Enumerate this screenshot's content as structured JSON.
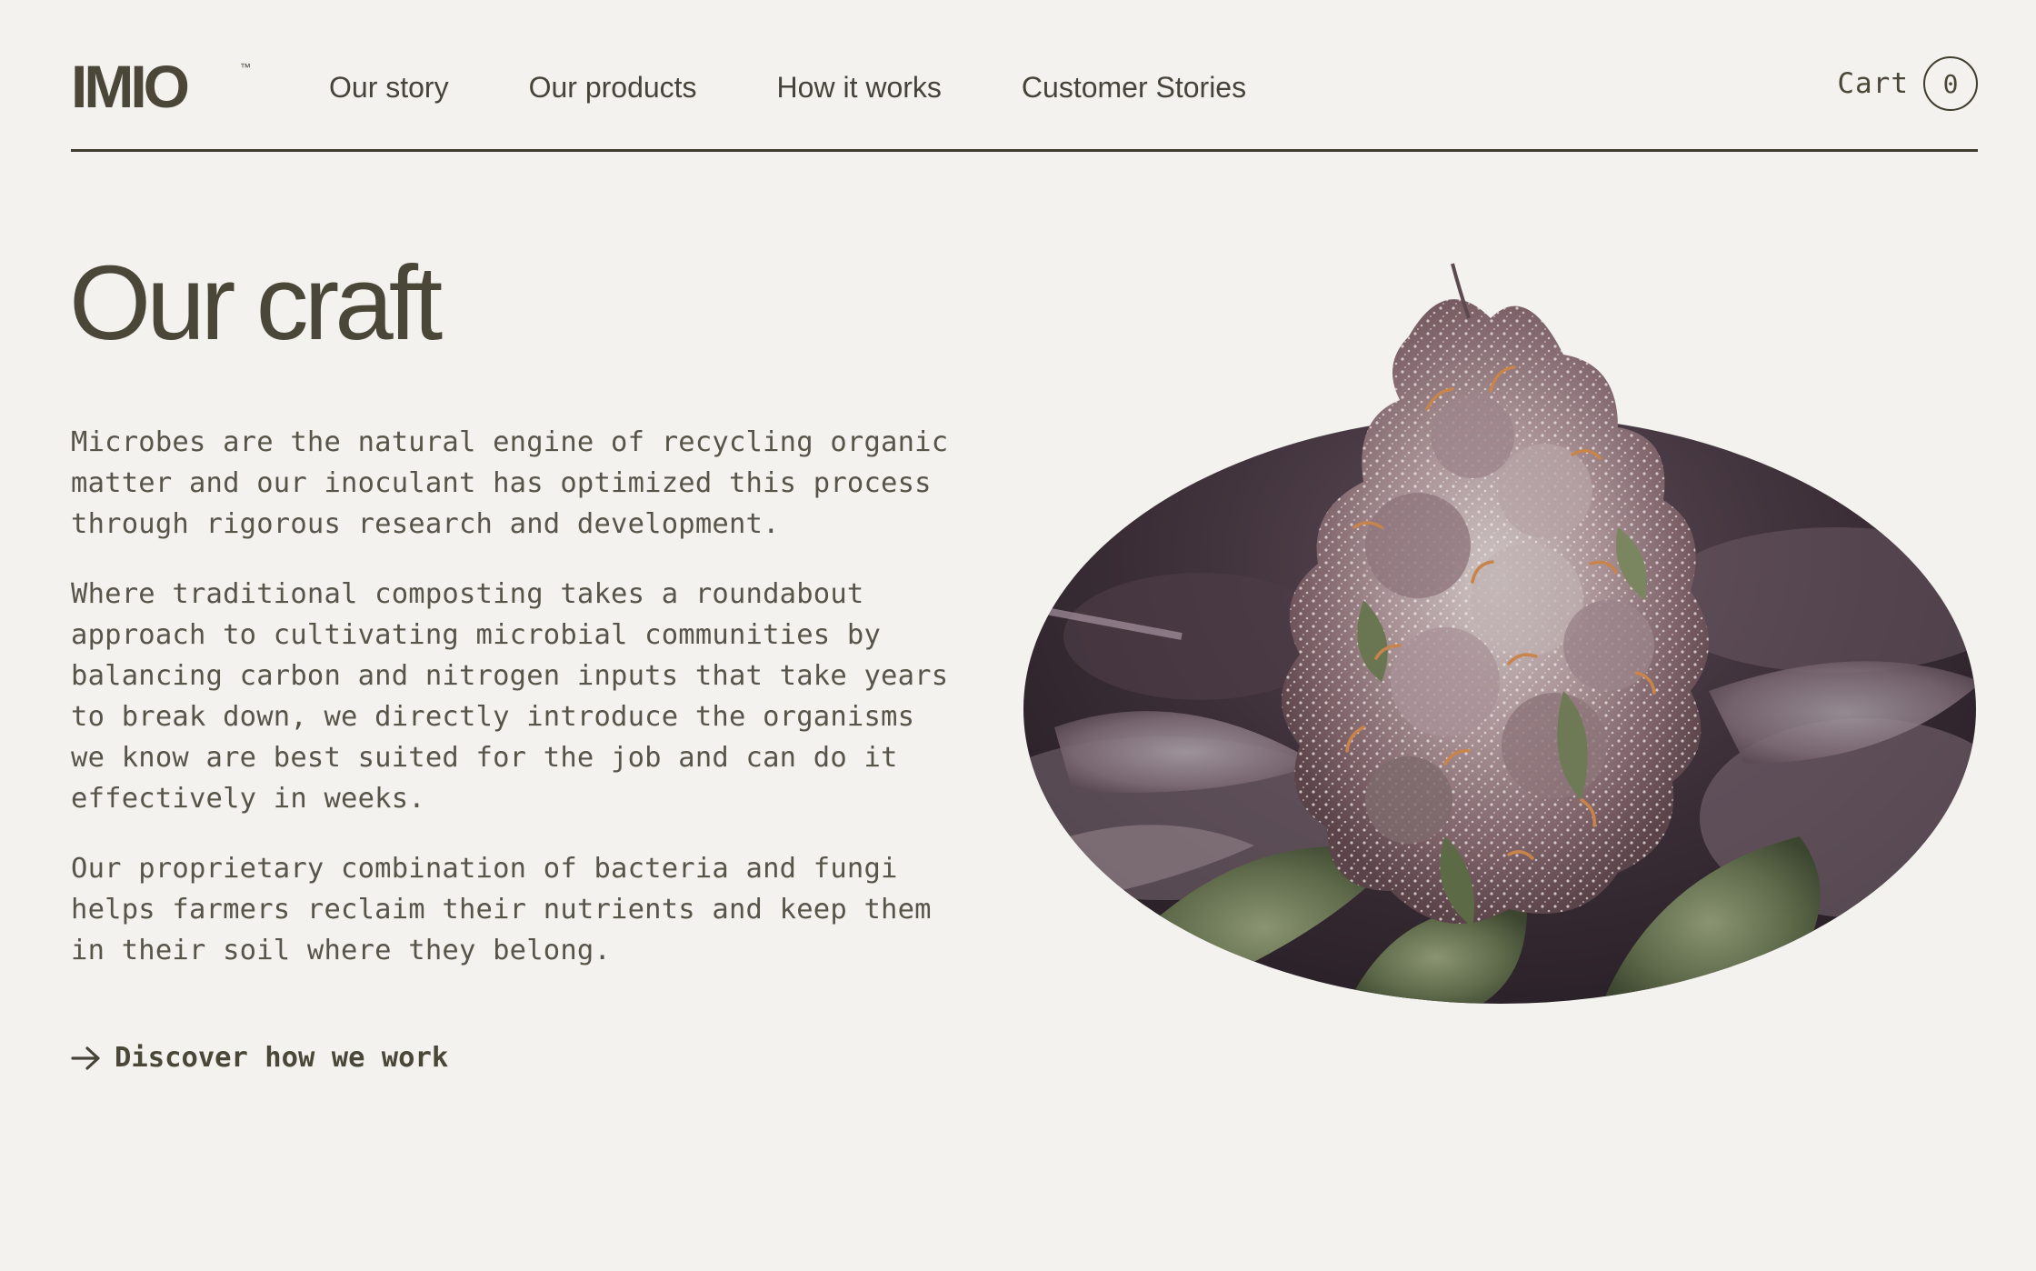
{
  "header": {
    "logo_text": "IMIO",
    "logo_trademark": "™",
    "nav": [
      {
        "label": "Our story"
      },
      {
        "label": "Our products"
      },
      {
        "label": "How it works"
      },
      {
        "label": "Customer Stories"
      }
    ],
    "cart_label": "Cart",
    "cart_count": "0"
  },
  "main": {
    "title": "Our craft",
    "paragraphs": [
      "Microbes are the natural engine of recycling organic matter and our inoculant has optimized this process through rigorous research and development.",
      "Where traditional composting takes a roundabout approach to cultivating microbial communities by balancing carbon and nitrogen inputs that take years to break down, we directly introduce the organisms we know are best suited for the job and can do it effectively in weeks.",
      "Our proprietary combination of bacteria and fungi helps farmers reclaim their nutrients and keep them in their soil where they belong."
    ],
    "cta_label": "Discover how we work"
  },
  "hero": {
    "image_subject": "frosted purple cannabis flower bud",
    "mask_shape": "ellipse"
  },
  "colors": {
    "background": "#f3f2ee",
    "text": "#4a4738",
    "rule": "#3f3d30"
  },
  "icons": {
    "cta": "arrow-right-icon"
  }
}
